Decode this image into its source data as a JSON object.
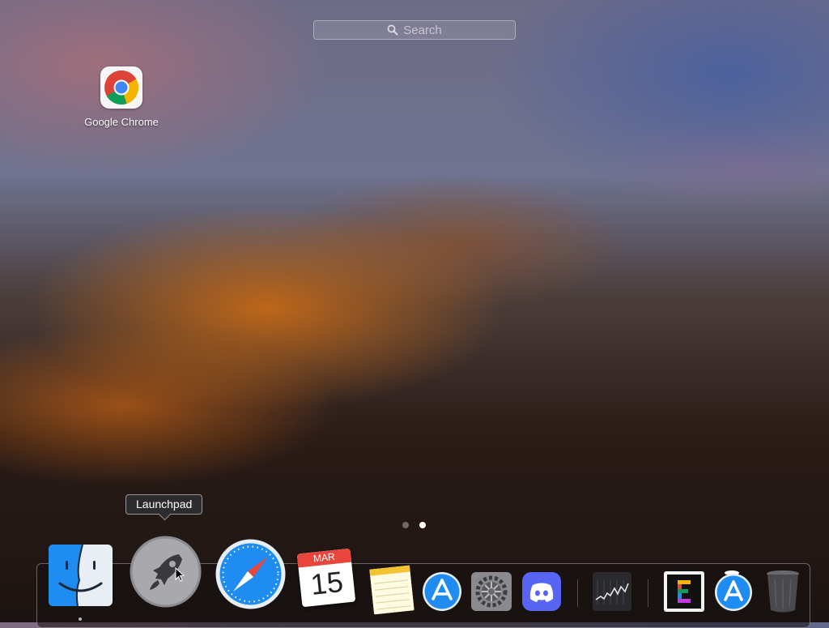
{
  "search": {
    "placeholder": "Search"
  },
  "apps": [
    {
      "name": "Google Chrome",
      "icon": "chrome-icon"
    }
  ],
  "pages": {
    "count": 2,
    "current": 2
  },
  "tooltip": {
    "text": "Launchpad"
  },
  "calendar": {
    "month": "MAR",
    "day": "15"
  },
  "dock": {
    "items": [
      {
        "name": "Finder",
        "icon": "finder-icon",
        "running": true
      },
      {
        "name": "Launchpad",
        "icon": "rocket-icon",
        "running": false
      },
      {
        "name": "Safari",
        "icon": "compass-icon",
        "running": false
      },
      {
        "name": "Calendar",
        "icon": "calendar-icon",
        "running": false
      },
      {
        "name": "Notes",
        "icon": "notes-icon",
        "running": false
      },
      {
        "name": "App Store",
        "icon": "app-store-icon",
        "running": false
      },
      {
        "name": "System Preferences",
        "icon": "gear-icon",
        "running": false
      },
      {
        "name": "Discord",
        "icon": "discord-icon",
        "running": false
      },
      {
        "name": "Stocks",
        "icon": "stocks-chart-icon",
        "running": false
      },
      {
        "name": "E app",
        "icon": "letter-e-icon",
        "running": false
      },
      {
        "name": "App Store downloads",
        "icon": "app-store-icon",
        "running": false
      },
      {
        "name": "Trash",
        "icon": "trash-icon",
        "running": false
      }
    ]
  },
  "colors": {
    "accent_blue": "#1e8cf0",
    "discord": "#5865f2",
    "calendar_red": "#e8453c"
  }
}
